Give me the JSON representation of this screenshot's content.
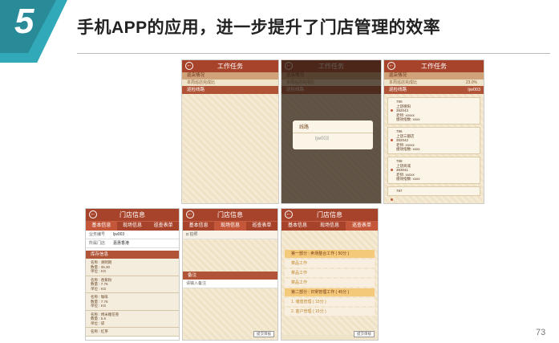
{
  "slide": {
    "number": "5",
    "title": "手机APP的应用，进一步提升了门店管理的效率",
    "page": "73"
  },
  "app": {
    "work_title": "工作任务",
    "inspect_section": "巡店情况",
    "inspect_note": "本周巡店完成比",
    "inspect_pct": "23.0%",
    "route_section": "巡检线路",
    "route_code": "ljw003",
    "dialog_title": "线路",
    "dialog_value": "ljw003",
    "store_title": "门店信息",
    "tabs": [
      "基本信息",
      "现场信息",
      "巡查表单"
    ],
    "cards": [
      {
        "id": "790",
        "name": "上饶德阳",
        "code": "392043",
        "owner": "老师: xxxxx",
        "count": "绩效指数: xxxx"
      },
      {
        "id": "786",
        "name": "上饶三都店",
        "code": "392042",
        "owner": "老师: xxxxx",
        "count": "绩效指数: xxxx"
      },
      {
        "id": "788",
        "name": "上饶商城",
        "code": "393041",
        "owner": "老师: xxxxx",
        "count": "绩效指数: xxxx"
      },
      {
        "id": "787"
      }
    ],
    "form": [
      {
        "label": "业务编号",
        "value": "ljw003"
      },
      {
        "label": "所属门店",
        "value": "嘉惠香港"
      }
    ],
    "list_header": "库存信息",
    "list_items": [
      [
        "名称 : 清明期",
        "数量 : 35.30",
        "单位 : KG"
      ],
      [
        "名称 : 香蕉粉",
        "数量 : 7.76",
        "单位 : KG"
      ],
      [
        "名称 : 咖啡",
        "数量 : 7.76",
        "单位 : KG"
      ],
      [
        "名称 : 烤米糖花卷",
        "数量 : 5.6",
        "单位 : 袋"
      ],
      [
        "名称 : 红茶"
      ]
    ],
    "photo_label": "拍照",
    "note_label": "备注",
    "note_placeholder": "请输入备注",
    "submit_label": "提交审核",
    "menus": [
      "第一部分 : 卖场整合工作 ( 50分 )",
      "菜品工作",
      "菜品工作",
      "菜品工作",
      "第二部分 : 日常管理工作 ( 45分 )",
      "1. 储值管理 ( 15分 )",
      "2. 客户管理 ( 15分 )"
    ]
  }
}
